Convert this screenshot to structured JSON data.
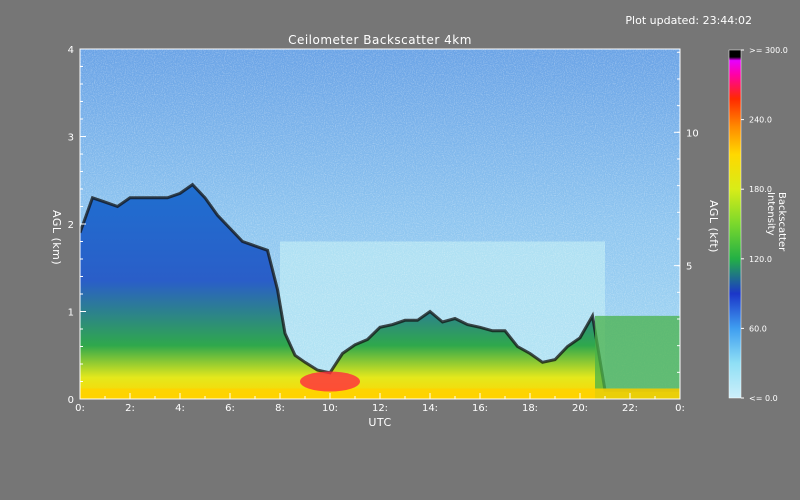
{
  "header": {
    "updated": "Plot updated: 23:44:02"
  },
  "chart_data": {
    "type": "heatmap",
    "title": "Ceilometer Backscatter 4km",
    "xlabel": "UTC",
    "ylabel": "AGL (km)",
    "ylabel_right": "AGL (kft)",
    "xlim": [
      0,
      24
    ],
    "ylim": [
      0,
      4
    ],
    "xticks": [
      "0:",
      "2:",
      "4:",
      "6:",
      "8:",
      "10:",
      "12:",
      "14:",
      "16:",
      "18:",
      "20:",
      "22:",
      "0:"
    ],
    "yticks": [
      "0",
      "1",
      "2",
      "3",
      "4"
    ],
    "yticks_right": [
      "5",
      "10"
    ],
    "yticks_right_values_kft": [
      5,
      10
    ],
    "colorbar": {
      "label": "Backscatter Intensity",
      "ticks": [
        "<= 0.0",
        "60.0",
        "120.0",
        "180.0",
        "240.0",
        ">= 300.0"
      ],
      "tick_values": [
        0,
        60,
        120,
        180,
        240,
        300
      ],
      "colors": [
        "#c9f0fb",
        "#8fdff5",
        "#3f9ef0",
        "#1b36c9",
        "#23b045",
        "#7ad82c",
        "#d8ec18",
        "#ffd800",
        "#ff8a00",
        "#ff2a00",
        "#ff00a8",
        "#e600ff",
        "#000000"
      ]
    },
    "layer_top_km": [
      [
        0.0,
        1.9
      ],
      [
        0.5,
        2.3
      ],
      [
        1.0,
        2.25
      ],
      [
        1.5,
        2.2
      ],
      [
        2.0,
        2.3
      ],
      [
        2.5,
        2.3
      ],
      [
        3.0,
        2.3
      ],
      [
        3.5,
        2.3
      ],
      [
        4.0,
        2.35
      ],
      [
        4.5,
        2.45
      ],
      [
        5.0,
        2.3
      ],
      [
        5.5,
        2.1
      ],
      [
        6.0,
        1.95
      ],
      [
        6.5,
        1.8
      ],
      [
        7.0,
        1.75
      ],
      [
        7.5,
        1.7
      ],
      [
        7.9,
        1.25
      ],
      [
        8.2,
        0.75
      ],
      [
        8.6,
        0.5
      ],
      [
        9.0,
        0.42
      ],
      [
        9.5,
        0.33
      ],
      [
        10.0,
        0.3
      ],
      [
        10.5,
        0.52
      ],
      [
        11.0,
        0.62
      ],
      [
        11.5,
        0.68
      ],
      [
        12.0,
        0.82
      ],
      [
        12.5,
        0.85
      ],
      [
        13.0,
        0.9
      ],
      [
        13.5,
        0.9
      ],
      [
        14.0,
        1.0
      ],
      [
        14.5,
        0.88
      ],
      [
        15.0,
        0.92
      ],
      [
        15.5,
        0.85
      ],
      [
        16.0,
        0.82
      ],
      [
        16.5,
        0.78
      ],
      [
        17.0,
        0.78
      ],
      [
        17.5,
        0.6
      ],
      [
        18.0,
        0.52
      ],
      [
        18.5,
        0.42
      ],
      [
        19.0,
        0.45
      ],
      [
        19.5,
        0.6
      ],
      [
        20.0,
        0.7
      ],
      [
        20.5,
        0.95
      ],
      [
        21.0,
        0.1
      ],
      [
        24.0,
        0.1
      ]
    ]
  }
}
